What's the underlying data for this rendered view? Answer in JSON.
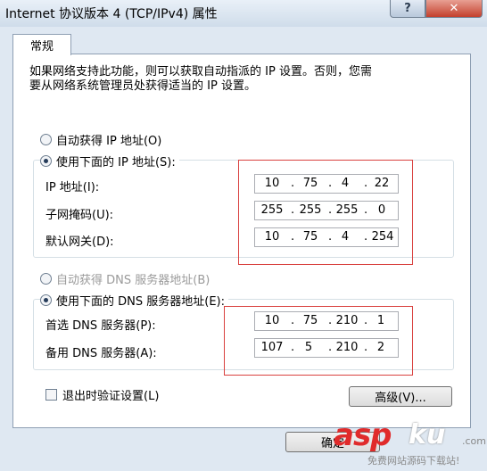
{
  "window": {
    "title": "Internet 协议版本 4 (TCP/IPv4) 属性",
    "help_label": "?",
    "close_label": "✕"
  },
  "tabs": [
    {
      "label": "常规",
      "active": true
    }
  ],
  "description": "如果网络支持此功能，则可以获取自动指派的 IP 设置。否则，您需\n要从网络系统管理员处获得适当的 IP 设置。",
  "ip_section": {
    "auto_label": "自动获得 IP 地址(O)",
    "manual_label": "使用下面的 IP 地址(S):",
    "selected": "manual",
    "fields": [
      {
        "label": "IP 地址(I):",
        "octets": [
          "10",
          "75",
          "4",
          "22"
        ]
      },
      {
        "label": "子网掩码(U):",
        "octets": [
          "255",
          "255",
          "255",
          "0"
        ]
      },
      {
        "label": "默认网关(D):",
        "octets": [
          "10",
          "75",
          "4",
          "254"
        ]
      }
    ]
  },
  "dns_section": {
    "auto_label": "自动获得 DNS 服务器地址(B)",
    "manual_label": "使用下面的 DNS 服务器地址(E):",
    "selected": "manual",
    "fields": [
      {
        "label": "首选 DNS 服务器(P):",
        "octets": [
          "10",
          "75",
          "210",
          "1"
        ]
      },
      {
        "label": "备用 DNS 服务器(A):",
        "octets": [
          "107",
          "5",
          "210",
          "2"
        ]
      }
    ]
  },
  "validate_label": "退出时验证设置(L)",
  "validate_checked": false,
  "advanced_label": "高级(V)...",
  "ok_label": "确定",
  "watermark": {
    "brand": "asp",
    "brand2": "ku",
    "suffix": ".com",
    "sub": "免费网站源码下载站!"
  },
  "colors": {
    "highlight": "#d9413f",
    "window_frame": "#dfe8f2"
  }
}
